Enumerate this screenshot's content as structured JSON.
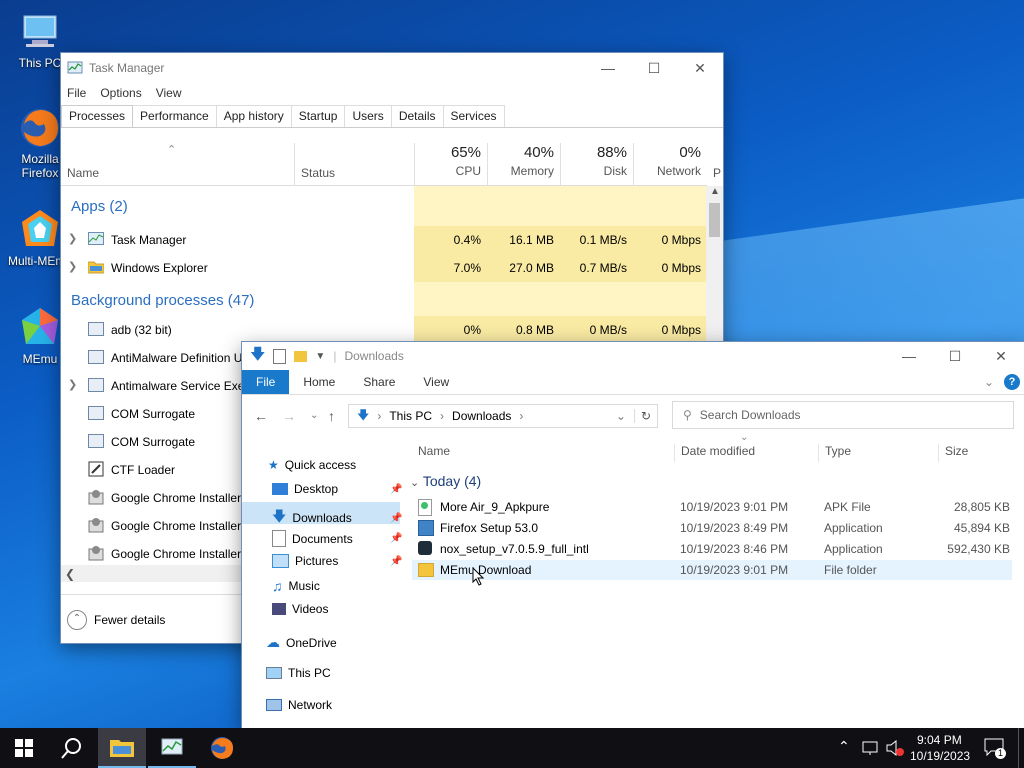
{
  "desktop": {
    "icons": [
      {
        "label": "This PC",
        "icon": "this-pc-icon"
      },
      {
        "label": "Mozilla Firefox",
        "icon": "firefox-icon"
      },
      {
        "label": "Multi-MEmu",
        "icon": "multi-memu-icon"
      },
      {
        "label": "MEmu",
        "icon": "memu-icon"
      }
    ]
  },
  "task_manager": {
    "title": "Task Manager",
    "menu": [
      "File",
      "Options",
      "View"
    ],
    "tabs": [
      "Processes",
      "Performance",
      "App history",
      "Startup",
      "Users",
      "Details",
      "Services"
    ],
    "active_tab": "Processes",
    "columns": {
      "name": "Name",
      "status": "Status",
      "cpu": {
        "pct": "65%",
        "label": "CPU"
      },
      "memory": {
        "pct": "40%",
        "label": "Memory"
      },
      "disk": {
        "pct": "88%",
        "label": "Disk"
      },
      "network": {
        "pct": "0%",
        "label": "Network"
      },
      "power": "P"
    },
    "apps_group": "Apps (2)",
    "apps": [
      {
        "name": "Task Manager",
        "cpu": "0.4%",
        "memory": "16.1 MB",
        "disk": "0.1 MB/s",
        "network": "0 Mbps"
      },
      {
        "name": "Windows Explorer",
        "cpu": "7.0%",
        "memory": "27.0 MB",
        "disk": "0.7 MB/s",
        "network": "0 Mbps"
      }
    ],
    "bg_group": "Background processes (47)",
    "bg": [
      {
        "name": "adb (32 bit)",
        "cpu": "0%",
        "memory": "0.8 MB",
        "disk": "0 MB/s",
        "network": "0 Mbps"
      },
      {
        "name": "AntiMalware Definition U"
      },
      {
        "name": "Antimalware Service Exec"
      },
      {
        "name": "COM Surrogate"
      },
      {
        "name": "COM Surrogate"
      },
      {
        "name": "CTF Loader"
      },
      {
        "name": "Google Chrome Installer"
      },
      {
        "name": "Google Chrome Installer"
      },
      {
        "name": "Google Chrome Installer"
      }
    ],
    "fewer_details": "Fewer details"
  },
  "explorer": {
    "title": "Downloads",
    "ribbon": [
      "File",
      "Home",
      "Share",
      "View"
    ],
    "breadcrumb": [
      "This PC",
      "Downloads"
    ],
    "search_placeholder": "Search Downloads",
    "nav": {
      "quick_access": "Quick access",
      "pinned": [
        "Desktop",
        "Downloads",
        "Documents",
        "Pictures"
      ],
      "unpinned": [
        "Music",
        "Videos"
      ],
      "onedrive": "OneDrive",
      "this_pc": "This PC",
      "network": "Network"
    },
    "columns": [
      "Name",
      "Date modified",
      "Type",
      "Size"
    ],
    "group": "Today (4)",
    "files": [
      {
        "name": "More Air_9_Apkpure",
        "date": "10/19/2023 9:01 PM",
        "type": "APK File",
        "size": "28,805 KB"
      },
      {
        "name": "Firefox Setup 53.0",
        "date": "10/19/2023 8:49 PM",
        "type": "Application",
        "size": "45,894 KB"
      },
      {
        "name": "nox_setup_v7.0.5.9_full_intl",
        "date": "10/19/2023 8:46 PM",
        "type": "Application",
        "size": "592,430 KB"
      },
      {
        "name": "MEmu Download",
        "date": "10/19/2023 9:01 PM",
        "type": "File folder",
        "size": ""
      }
    ]
  },
  "taskbar": {
    "time": "9:04 PM",
    "date": "10/19/2023",
    "notifications": "1"
  }
}
